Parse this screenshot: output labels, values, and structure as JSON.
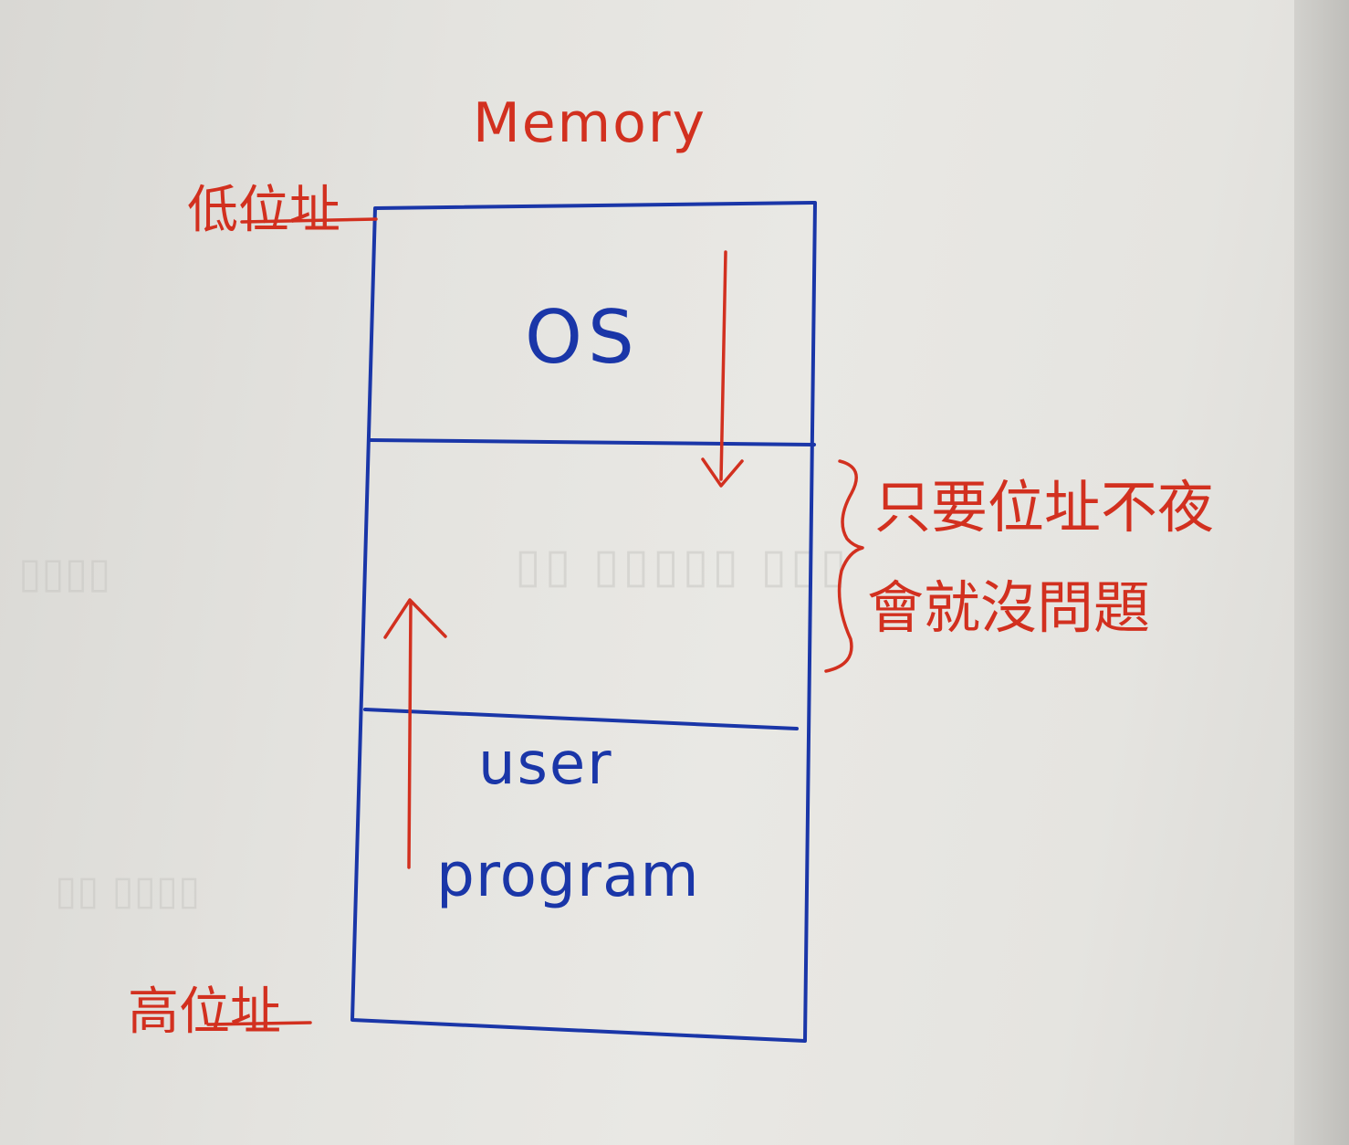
{
  "title": "Memory",
  "labels": {
    "low_address": "低位址",
    "high_address": "高位址"
  },
  "regions": {
    "os": "OS",
    "user_line1": "user",
    "user_line2": "program"
  },
  "note": {
    "line1": "只要位址不夜",
    "line2": "會就沒問題"
  },
  "colors": {
    "red_ink": "#d2301f",
    "blue_ink": "#1a36a8",
    "paper": "#e6e5e1"
  }
}
